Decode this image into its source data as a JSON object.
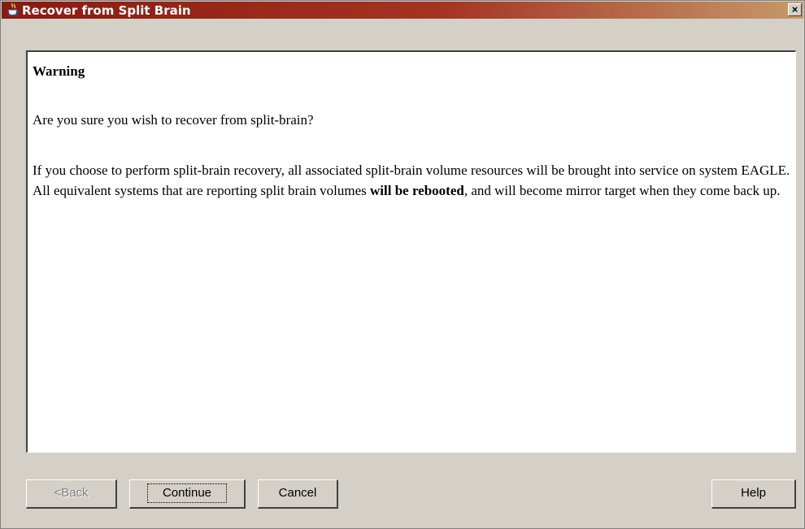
{
  "window": {
    "title": "Recover from Split Brain",
    "icon": "java-coffee-cup-icon",
    "close_label": "×"
  },
  "content": {
    "heading": "Warning",
    "question": "Are you sure you wish to recover from split-brain?",
    "body_part1": "If you choose to perform split-brain recovery, all associated split-brain volume resources will be brought into service on system EAGLE. All equivalent systems that are reporting split brain volumes ",
    "body_bold": "will be rebooted",
    "body_part2": ", and will become mirror target when they come back up."
  },
  "buttons": {
    "back": "<Back",
    "continue": "Continue",
    "cancel": "Cancel",
    "help": "Help"
  }
}
